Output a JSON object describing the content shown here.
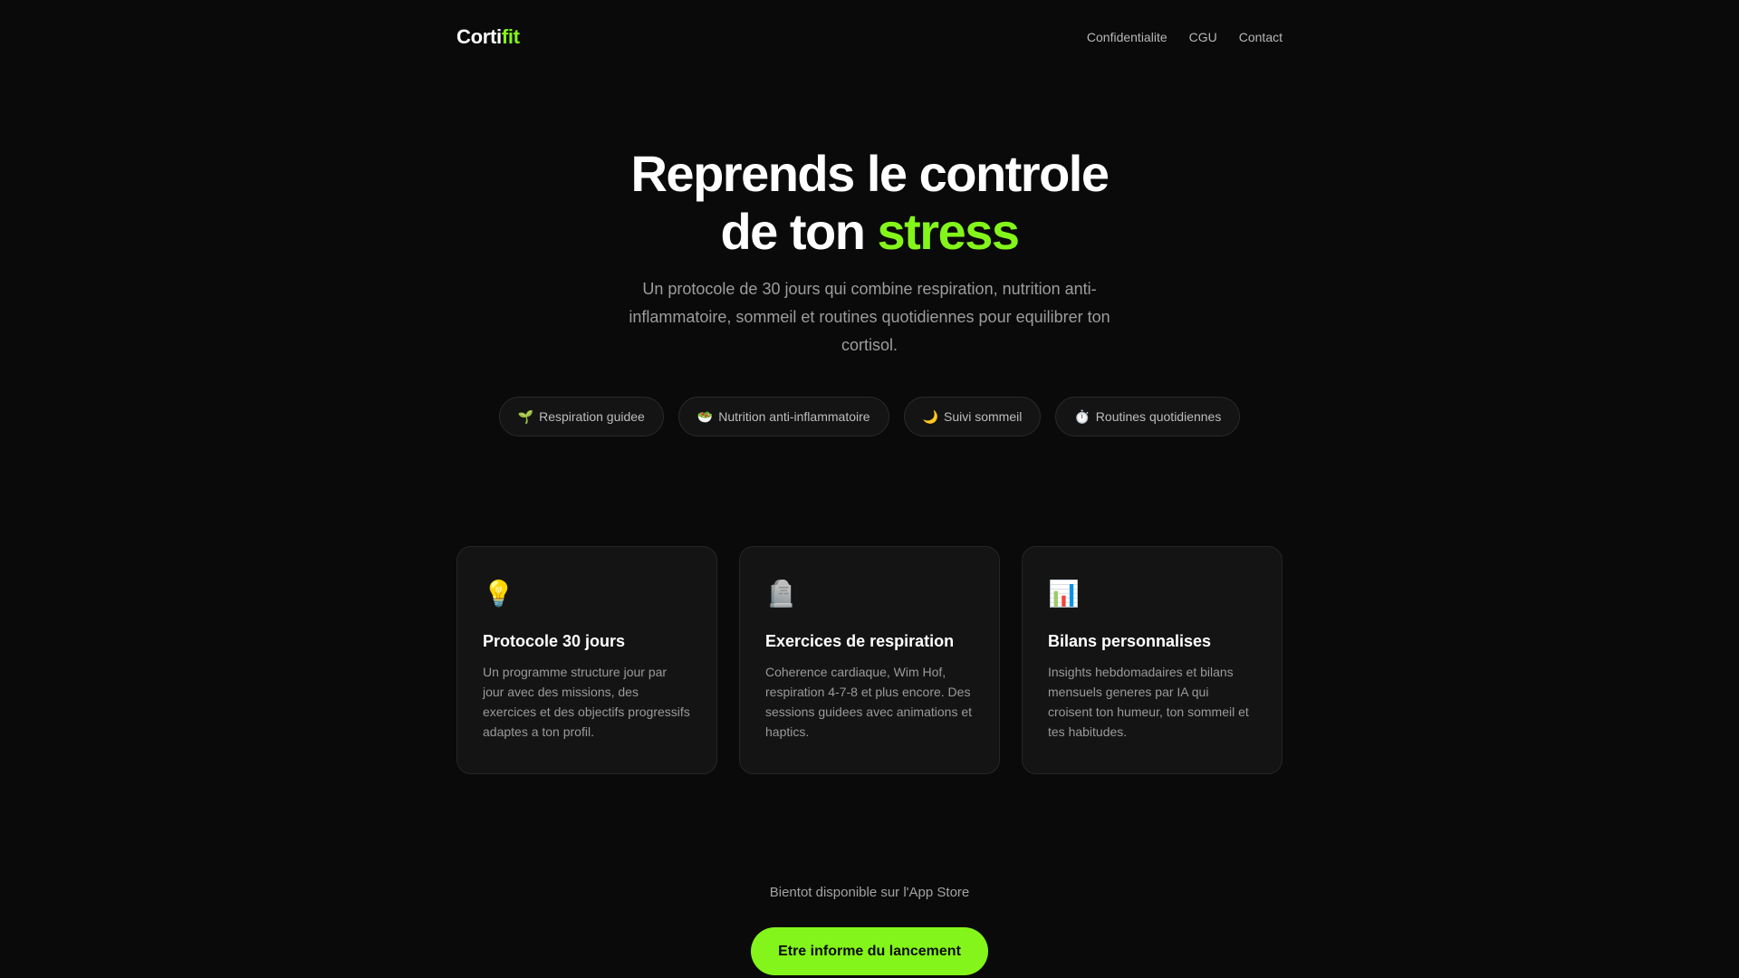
{
  "nav": {
    "logo_main": "Corti",
    "logo_accent": "fit",
    "links": [
      "Confidentialite",
      "CGU",
      "Contact"
    ]
  },
  "hero": {
    "title_line1": "Reprends le controle",
    "title_line2_prefix": "de ton ",
    "title_line2_accent": "stress",
    "subtitle": "Un protocole de 30 jours qui combine respiration, nutrition anti-inflammatoire, sommeil et routines quotidiennes pour equilibrer ton cortisol."
  },
  "chips": [
    {
      "icon": "🌱",
      "icon_name": "seedling-icon",
      "label": "Respiration guidee"
    },
    {
      "icon": "🥗",
      "icon_name": "salad-icon",
      "label": "Nutrition anti-inflammatoire"
    },
    {
      "icon": "🌙",
      "icon_name": "moon-icon",
      "label": "Suivi sommeil"
    },
    {
      "icon": "⏱️",
      "icon_name": "stopwatch-icon",
      "label": "Routines quotidiennes"
    }
  ],
  "cards": [
    {
      "icon": "💡",
      "icon_name": "lightbulb-icon",
      "title": "Protocole 30 jours",
      "text": "Un programme structure jour par jour avec des missions, des exercices et des objectifs progressifs adaptes a ton profil."
    },
    {
      "icon": "🪦",
      "icon_name": "headstone-icon",
      "title": "Exercices de respiration",
      "text": "Coherence cardiaque, Wim Hof, respiration 4-7-8 et plus encore. Des sessions guidees avec animations et haptics."
    },
    {
      "icon": "📊",
      "icon_name": "bar-chart-icon",
      "title": "Bilans personnalises",
      "text": "Insights hebdomadaires et bilans mensuels generes par IA qui croisent ton humeur, ton sommeil et tes habitudes."
    }
  ],
  "cta": {
    "label": "Bientot disponible sur l'App Store",
    "button": "Etre informe du lancement"
  },
  "colors": {
    "background": "#0a0a0a",
    "accent": "#84f51a",
    "card_bg": "#141414"
  }
}
